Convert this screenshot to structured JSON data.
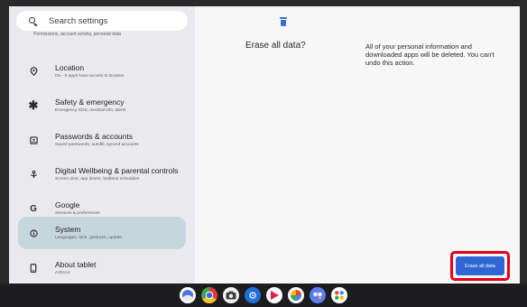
{
  "search": {
    "placeholder": "Search settings"
  },
  "sidebar": {
    "partial_sub": "Permissions, account activity, personal data",
    "items": [
      {
        "title": "Location",
        "sub": "On - 0 apps have access to location",
        "icon": "location-pin-icon"
      },
      {
        "title": "Safety & emergency",
        "sub": "Emergency SOS, medical info, alerts",
        "icon": "asterisk-icon"
      },
      {
        "title": "Passwords & accounts",
        "sub": "Saved passwords, autofill, synced accounts",
        "icon": "account-box-icon"
      },
      {
        "title": "Digital Wellbeing & parental controls",
        "sub": "Screen time, app timers, bedtime schedules",
        "icon": "wellbeing-icon"
      },
      {
        "title": "Google",
        "sub": "Services & preferences",
        "icon": "google-g-icon"
      },
      {
        "title": "System",
        "sub": "Languages, time, gestures, update",
        "icon": "info-circle-icon",
        "selected": true
      },
      {
        "title": "About tablet",
        "sub": "A301LV",
        "icon": "tablet-icon"
      }
    ]
  },
  "detail": {
    "title": "Erase all data?",
    "description": "All of your personal information and downloaded apps will be deleted. You can't undo this action.",
    "button_label": "Erase all data"
  },
  "dock": {
    "apps": [
      "assistant-icon",
      "chrome-icon",
      "camera-icon",
      "settings-icon",
      "play-store-icon",
      "photos-icon",
      "assistant-dots-icon",
      "app-drawer-icon"
    ]
  },
  "colors": {
    "accent": "#2f66d4",
    "highlight": "#e60012",
    "selected_item": "#c5d7dd"
  }
}
